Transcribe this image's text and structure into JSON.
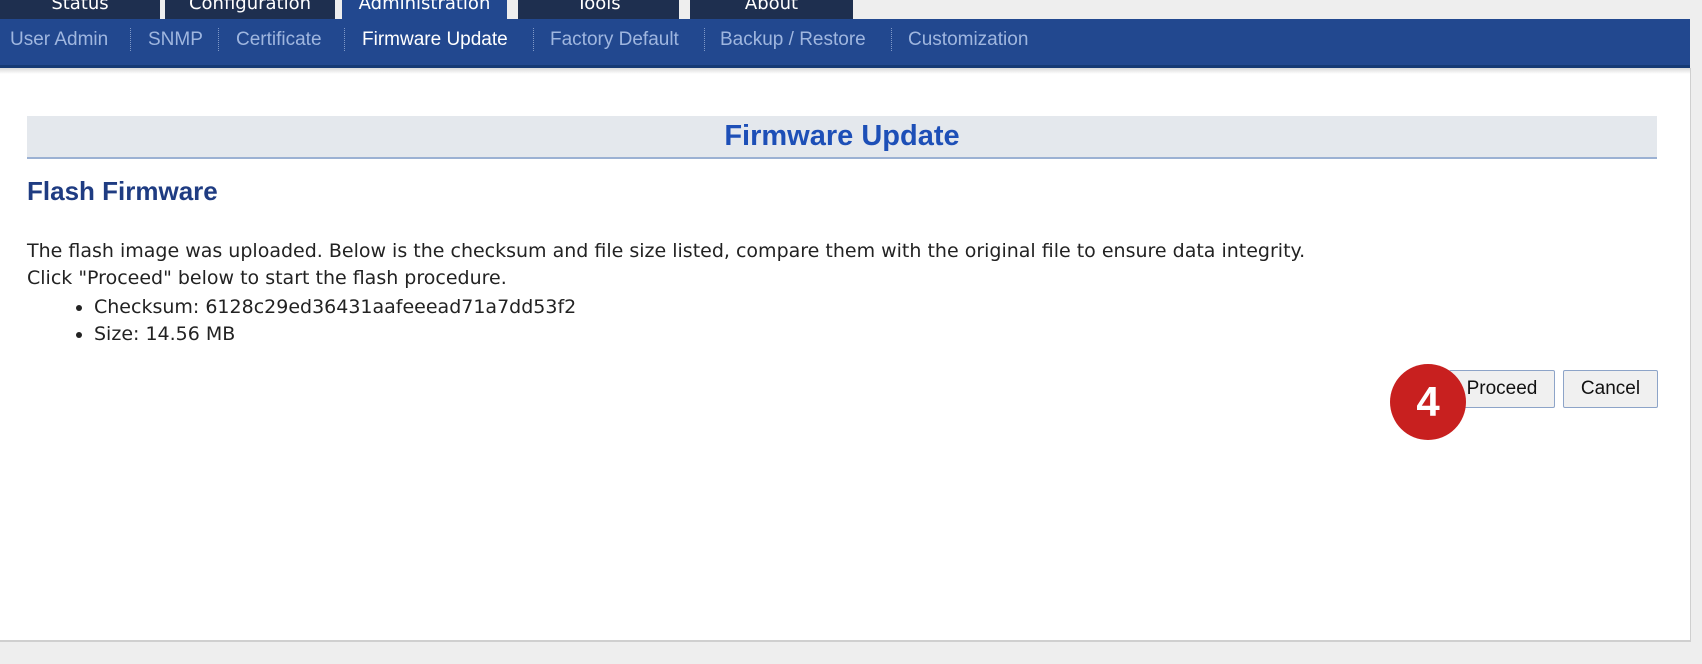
{
  "main_tabs": [
    {
      "label": "Status"
    },
    {
      "label": "Configuration"
    },
    {
      "label": "Administration",
      "active": true
    },
    {
      "label": "Tools"
    },
    {
      "label": "About"
    }
  ],
  "subnav": {
    "items": [
      {
        "label": "User Admin"
      },
      {
        "label": "SNMP"
      },
      {
        "label": "Certificate"
      },
      {
        "label": "Firmware Update",
        "active": true
      },
      {
        "label": "Factory Default"
      },
      {
        "label": "Backup / Restore"
      },
      {
        "label": "Customization"
      }
    ]
  },
  "page": {
    "title": "Firmware Update",
    "section_heading": "Flash Firmware",
    "description_line1": "The flash image was uploaded. Below is the checksum and file size listed, compare them with the original file to ensure data integrity.",
    "description_line2": "Click \"Proceed\" below to start the flash procedure.",
    "checksum": "Checksum: 6128c29ed36431aafeeead71a7dd53f2",
    "size": "Size: 14.56 MB"
  },
  "buttons": {
    "proceed_label": "Proceed",
    "cancel_label": "Cancel"
  },
  "annotation": {
    "step_number": "4"
  },
  "colors": {
    "nav_blue": "#22488f",
    "dark_tab": "#1e2f4f",
    "title_blue": "#1d4fb7",
    "badge_red": "#c8201f"
  }
}
